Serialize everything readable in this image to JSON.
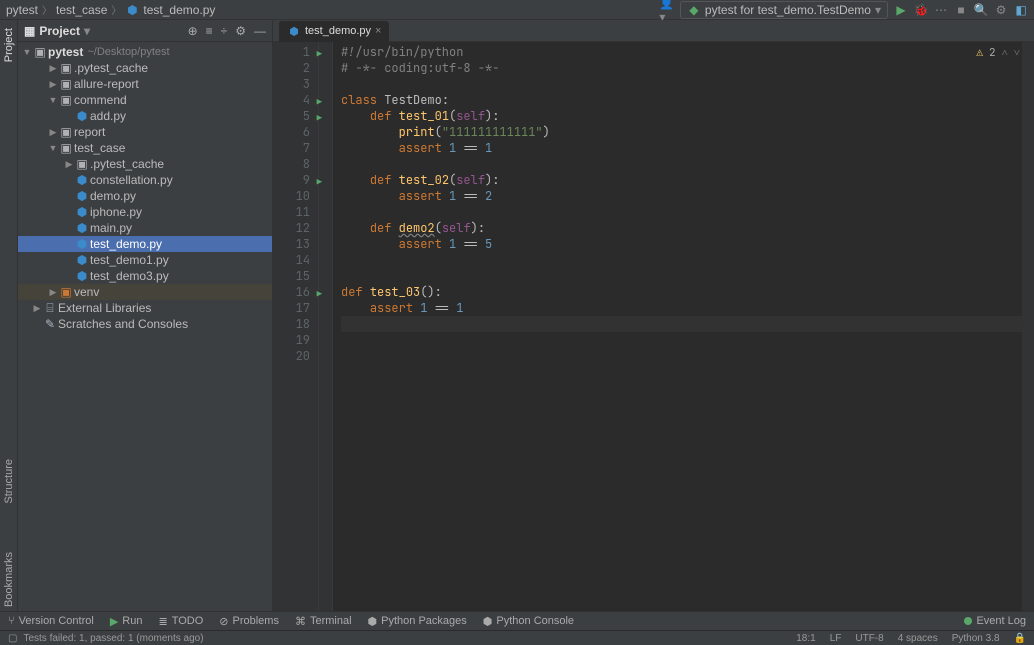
{
  "breadcrumb": {
    "root": "pytest",
    "folder": "test_case",
    "file": "test_demo.py"
  },
  "runcfg": {
    "label": "pytest for test_demo.TestDemo"
  },
  "project_header": {
    "title": "Project"
  },
  "tree": {
    "root_name": "pytest",
    "root_path": "~/Desktop/pytest",
    "items": [
      {
        "depth": 1,
        "arrow": "▶",
        "icon": "folder",
        "label": ".pytest_cache"
      },
      {
        "depth": 1,
        "arrow": "▶",
        "icon": "folder",
        "label": "allure-report"
      },
      {
        "depth": 1,
        "arrow": "▼",
        "icon": "folder",
        "label": "commend"
      },
      {
        "depth": 2,
        "arrow": "",
        "icon": "py",
        "label": "add.py"
      },
      {
        "depth": 1,
        "arrow": "▶",
        "icon": "folder",
        "label": "report"
      },
      {
        "depth": 1,
        "arrow": "▼",
        "icon": "folder",
        "label": "test_case"
      },
      {
        "depth": 2,
        "arrow": "▶",
        "icon": "folder",
        "label": ".pytest_cache"
      },
      {
        "depth": 2,
        "arrow": "",
        "icon": "py",
        "label": "constellation.py"
      },
      {
        "depth": 2,
        "arrow": "",
        "icon": "py",
        "label": "demo.py"
      },
      {
        "depth": 2,
        "arrow": "",
        "icon": "py",
        "label": "iphone.py"
      },
      {
        "depth": 2,
        "arrow": "",
        "icon": "py",
        "label": "main.py"
      },
      {
        "depth": 2,
        "arrow": "",
        "icon": "py",
        "label": "test_demo.py",
        "selected": true
      },
      {
        "depth": 2,
        "arrow": "",
        "icon": "py",
        "label": "test_demo1.py"
      },
      {
        "depth": 2,
        "arrow": "",
        "icon": "py",
        "label": "test_demo3.py"
      },
      {
        "depth": 1,
        "arrow": "▶",
        "icon": "venv",
        "label": "venv",
        "excluded": true
      },
      {
        "depth": 0,
        "arrow": "▶",
        "icon": "lib",
        "label": "External Libraries"
      },
      {
        "depth": 0,
        "arrow": "",
        "icon": "scratch",
        "label": "Scratches and Consoles"
      }
    ]
  },
  "tabs": [
    {
      "label": "test_demo.py",
      "active": true
    }
  ],
  "editor": {
    "inspection_warnings": "2",
    "lines": [
      {
        "n": 1,
        "run": true,
        "html": "<span class='cm'>#!/usr/bin/python</span>"
      },
      {
        "n": 2,
        "run": false,
        "html": "<span class='cm'># -*- coding:utf-8 -*-</span>"
      },
      {
        "n": 3,
        "run": false,
        "html": ""
      },
      {
        "n": 4,
        "run": true,
        "html": "<span class='kw'>class</span> TestDemo:"
      },
      {
        "n": 5,
        "run": true,
        "html": "    <span class='kw'>def</span> <span class='fn'>test_01</span>(<span class='slf'>self</span>):"
      },
      {
        "n": 6,
        "run": false,
        "html": "        <span class='fn'>print</span>(<span class='str'>\"111111111111\"</span>)"
      },
      {
        "n": 7,
        "run": false,
        "html": "        <span class='kw'>assert</span> <span class='num'>1</span> == <span class='num'>1</span>"
      },
      {
        "n": 8,
        "run": false,
        "html": ""
      },
      {
        "n": 9,
        "run": true,
        "html": "    <span class='kw'>def</span> <span class='fn'>test_02</span>(<span class='slf'>self</span>):"
      },
      {
        "n": 10,
        "run": false,
        "html": "        <span class='kw'>assert</span> <span class='num'>1</span> == <span class='num'>2</span>"
      },
      {
        "n": 11,
        "run": false,
        "html": ""
      },
      {
        "n": 12,
        "run": false,
        "html": "    <span class='kw'>def</span> <span class='fn und'>demo2</span>(<span class='slf'>self</span>):"
      },
      {
        "n": 13,
        "run": false,
        "html": "        <span class='kw'>assert</span> <span class='num'>1</span> == <span class='num'>5</span>"
      },
      {
        "n": 14,
        "run": false,
        "html": ""
      },
      {
        "n": 15,
        "run": false,
        "html": ""
      },
      {
        "n": 16,
        "run": true,
        "html": "<span class='kw'>def</span> <span class='fn'>test_03</span>():"
      },
      {
        "n": 17,
        "run": false,
        "html": "    <span class='kw'>assert</span> <span class='num'>1</span> == <span class='num'>1</span>"
      },
      {
        "n": 18,
        "run": false,
        "html": "",
        "current": true
      },
      {
        "n": 19,
        "run": false,
        "html": ""
      },
      {
        "n": 20,
        "run": false,
        "html": ""
      }
    ]
  },
  "left_rail": {
    "project": "Project",
    "structure": "Structure",
    "bookmarks": "Bookmarks"
  },
  "bottom_tabs": {
    "version_control": "Version Control",
    "run": "Run",
    "todo": "TODO",
    "problems": "Problems",
    "terminal": "Terminal",
    "python_packages": "Python Packages",
    "python_console": "Python Console",
    "event_log": "Event Log"
  },
  "status": {
    "msg": "Tests failed: 1, passed: 1 (moments ago)",
    "caret": "18:1",
    "line_sep": "LF",
    "encoding": "UTF-8",
    "indent": "4 spaces",
    "interpreter": "Python 3.8"
  }
}
